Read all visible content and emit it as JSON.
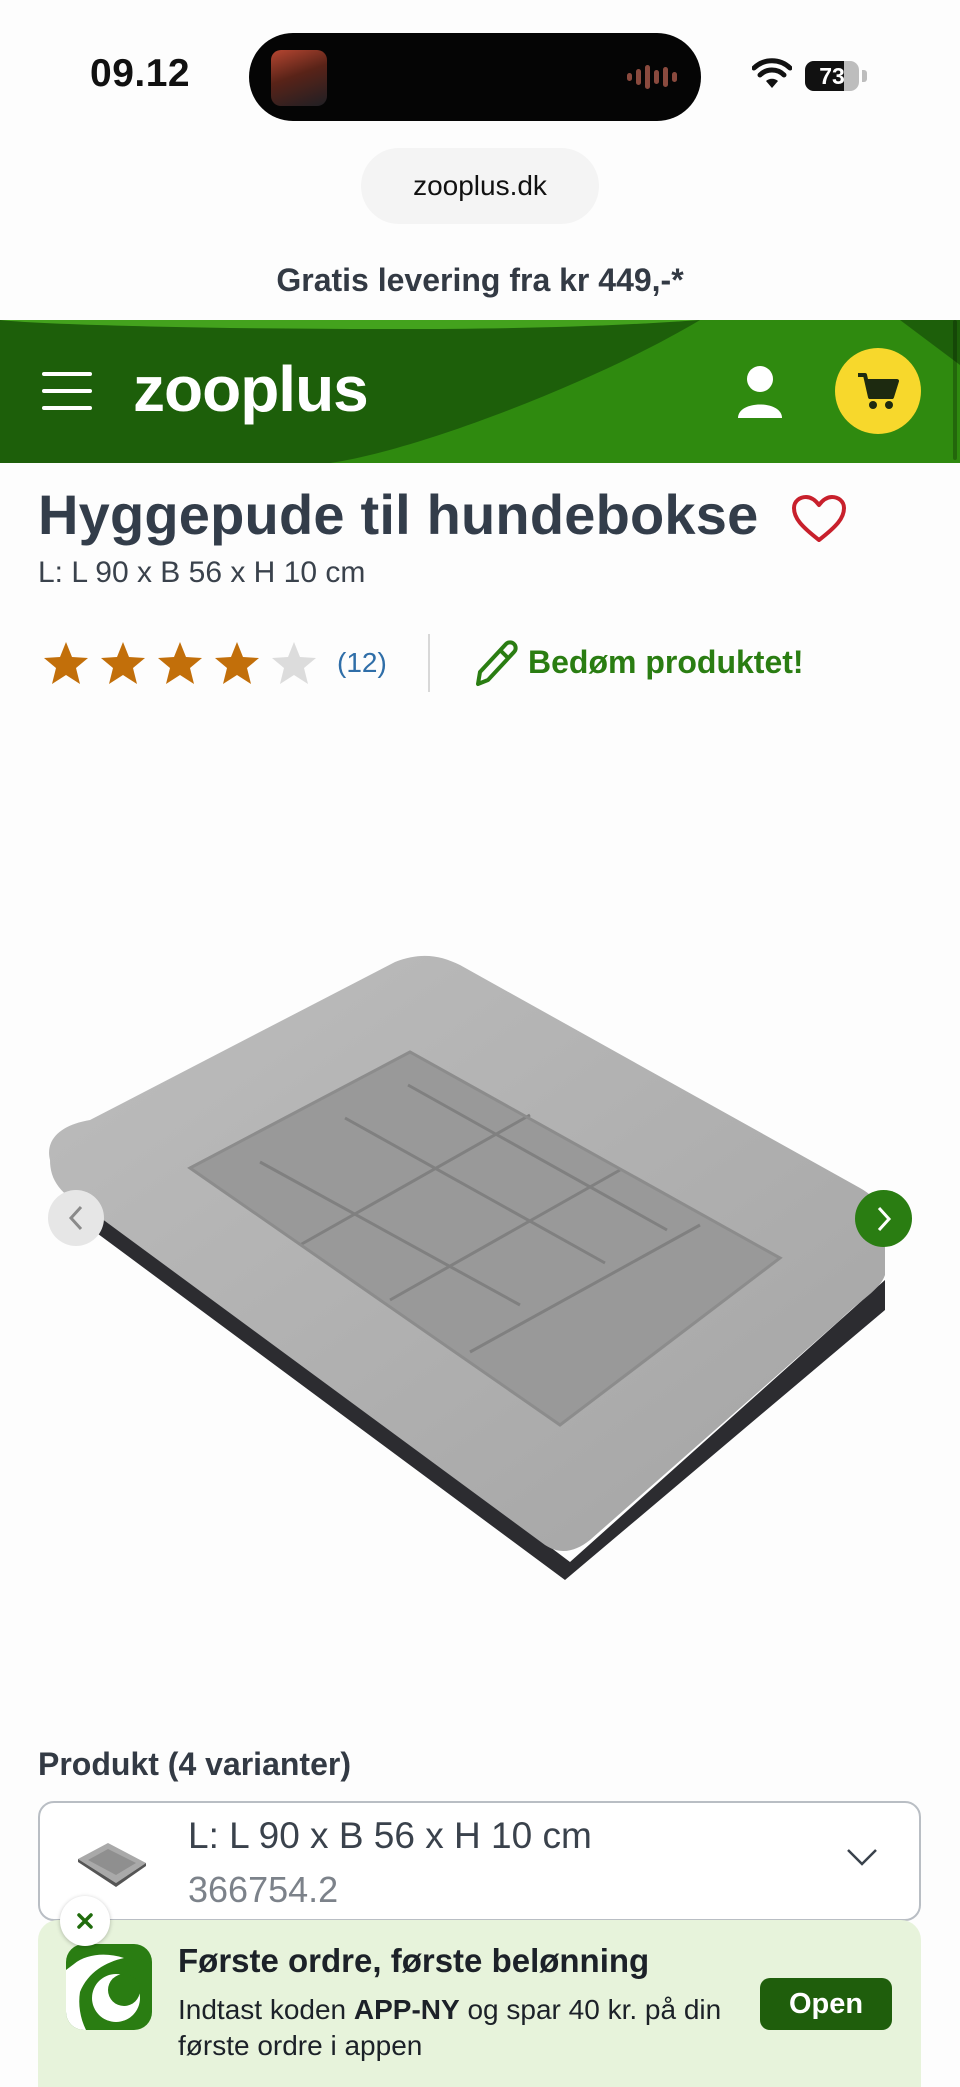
{
  "status_bar": {
    "time": "09.12",
    "battery": "73",
    "battery_level": 0.73
  },
  "browser": {
    "url": "zooplus.dk"
  },
  "promo": {
    "text": "Gratis levering fra kr 449,-*"
  },
  "header": {
    "logo": "zooplus",
    "colors": {
      "dark": "#1d5f0a",
      "light": "#2f8a0f",
      "cart": "#f7d82c"
    }
  },
  "product": {
    "title": "Hyggepude til hundebokse",
    "size": "L: L 90 x B 56 x H 10 cm",
    "rating": {
      "stars": 4,
      "max": 5,
      "count": "(12)"
    },
    "rate_label": "Bedøm produktet!"
  },
  "variants": {
    "label": "Produkt (4 varianter)",
    "selected": {
      "name": "L: L 90 x B 56 x H 10 cm",
      "sku": "366754.2"
    }
  },
  "app_banner": {
    "title": "Første ordre, første belønning",
    "text_before": "Indtast koden ",
    "code": "APP-NY",
    "text_after": " og spar 40 kr. på din første ordre i appen",
    "open_label": "Open"
  }
}
